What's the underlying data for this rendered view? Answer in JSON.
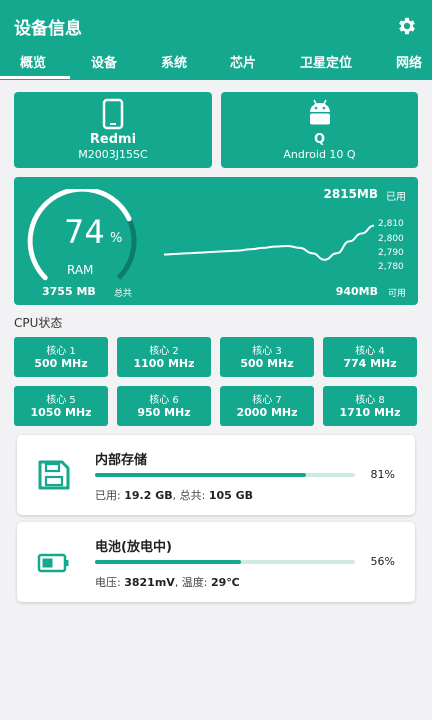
{
  "app": {
    "title": "设备信息"
  },
  "tabs": [
    "概览",
    "设备",
    "系统",
    "芯片",
    "卫星定位",
    "网络"
  ],
  "device": {
    "brand": "Redmi",
    "model": "M2003J15SC",
    "os_code": "Q",
    "os_name": "Android 10 Q"
  },
  "ram": {
    "percent": 74,
    "percent_sign": "%",
    "label": "RAM",
    "total": "3755 MB",
    "total_label": "总共",
    "used": "2815MB",
    "used_label": "已用",
    "available": "940MB",
    "available_label": "可用"
  },
  "chart_data": {
    "type": "line",
    "y_ticks": [
      "2,810",
      "2,800",
      "2,790",
      "2,780"
    ],
    "ylim": [
      2776,
      2814
    ],
    "series": [
      {
        "values": [
          2787,
          2787.5,
          2788,
          2788.5,
          2789,
          2789.5,
          2790,
          2791,
          2792,
          2793,
          2793.5,
          2792,
          2788,
          2783,
          2788,
          2797,
          2803,
          2809
        ]
      }
    ]
  },
  "cpu": {
    "title": "CPU状态",
    "cores": [
      {
        "name": "核心 1",
        "freq": "500 MHz"
      },
      {
        "name": "核心 2",
        "freq": "1100 MHz"
      },
      {
        "name": "核心 3",
        "freq": "500 MHz"
      },
      {
        "name": "核心 4",
        "freq": "774 MHz"
      },
      {
        "name": "核心 5",
        "freq": "1050 MHz"
      },
      {
        "name": "核心 6",
        "freq": "950 MHz"
      },
      {
        "name": "核心 7",
        "freq": "2000 MHz"
      },
      {
        "name": "核心 8",
        "freq": "1710 MHz"
      }
    ]
  },
  "storage": {
    "title": "内部存储",
    "percent": 81,
    "percent_text": "81%",
    "used_label": "已用:",
    "used": "19.2 GB",
    "total_label": ", 总共:",
    "total": "105 GB"
  },
  "battery": {
    "title": "电池(放电中)",
    "percent": 56,
    "percent_text": "56%",
    "voltage_label": "电压:",
    "voltage": "3821mV",
    "temp_label": ", 温度:",
    "temp": "29℃"
  },
  "colors": {
    "accent": "#14a88e",
    "track": "#cfe9e3",
    "gauge_dark": "#0c7d69"
  },
  "icons": [
    "gear-icon",
    "phone-icon",
    "android-icon",
    "floppy-disk-icon",
    "battery-icon"
  ]
}
